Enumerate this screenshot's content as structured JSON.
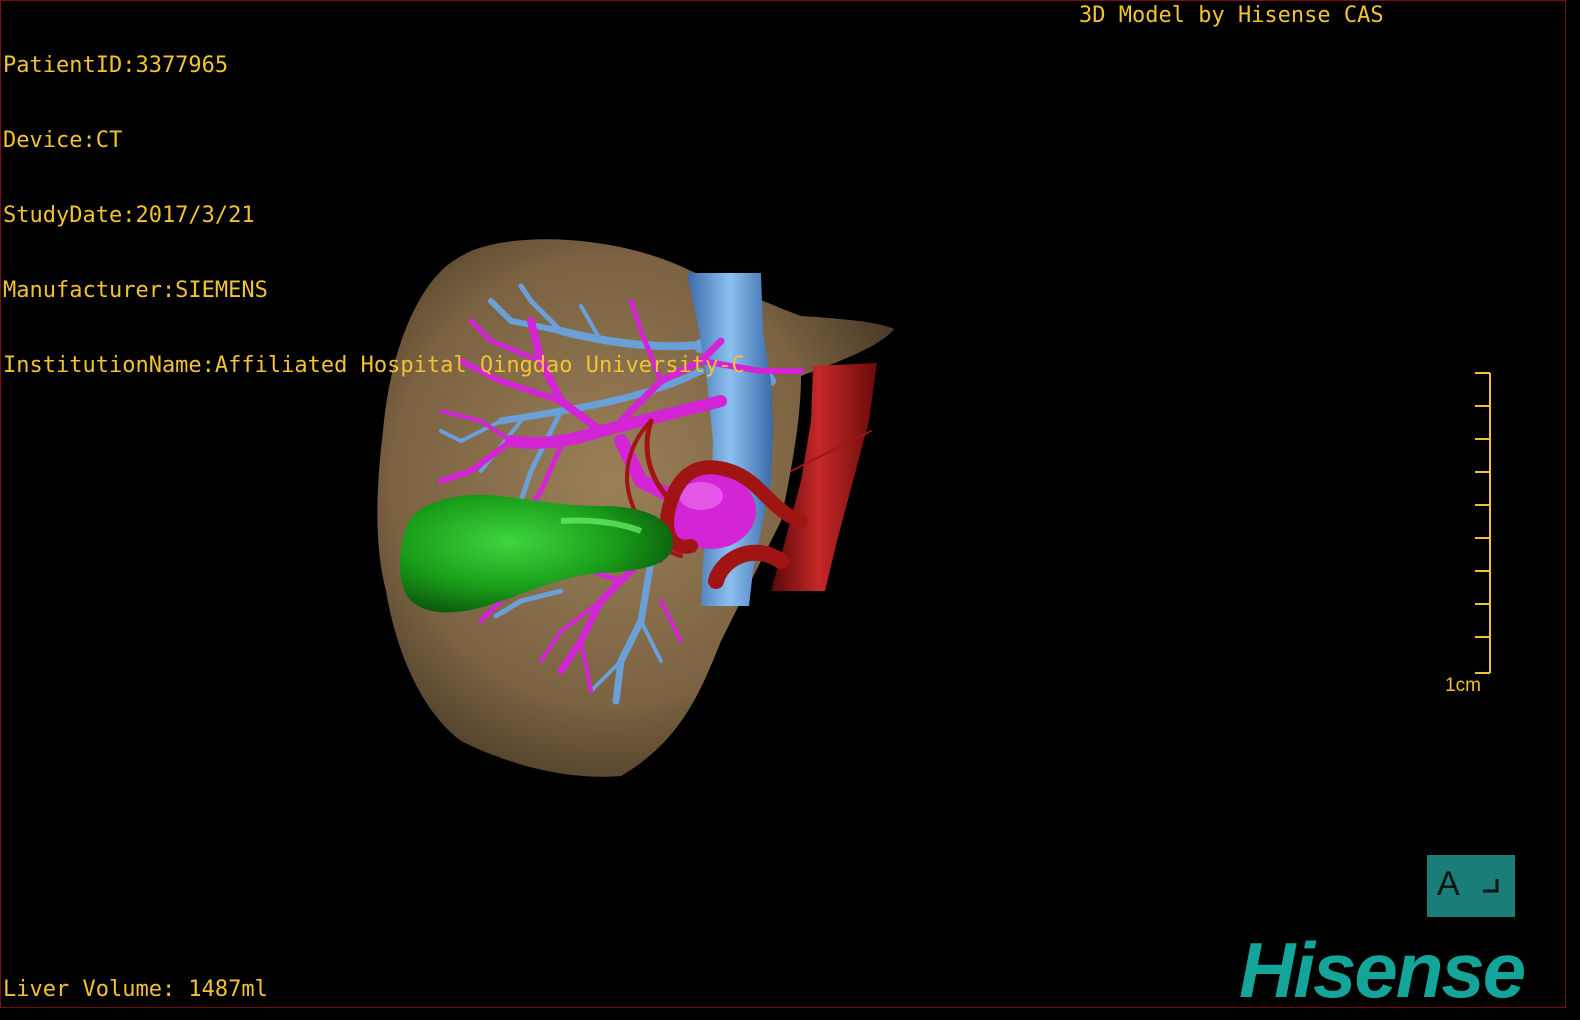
{
  "patient": {
    "patient_id_line": "PatientID:3377965",
    "device_line": "Device:CT",
    "study_date_line": "StudyDate:2017/3/21",
    "manufacturer_line": "Manufacturer:SIEMENS",
    "institution_line": "InstitutionName:Affiliated Hospital Qingdao University-C"
  },
  "credit": "3D Model by Hisense CAS",
  "liver_volume_line": "Liver Volume: 1487ml",
  "scale": {
    "label": "1cm"
  },
  "orientation": {
    "letter": "A"
  },
  "brand": {
    "logo_text": "Hisense"
  },
  "colors": {
    "text": "#f1c232",
    "liver": "#7d6545",
    "portal_vein": "#d324d6",
    "hepatic_vein": "#6a9fd8",
    "artery": "#a01414",
    "gallbladder": "#1aa11a",
    "brand": "#13a59a"
  },
  "icons": [
    "orientation-cube-icon",
    "hisense-logo"
  ]
}
